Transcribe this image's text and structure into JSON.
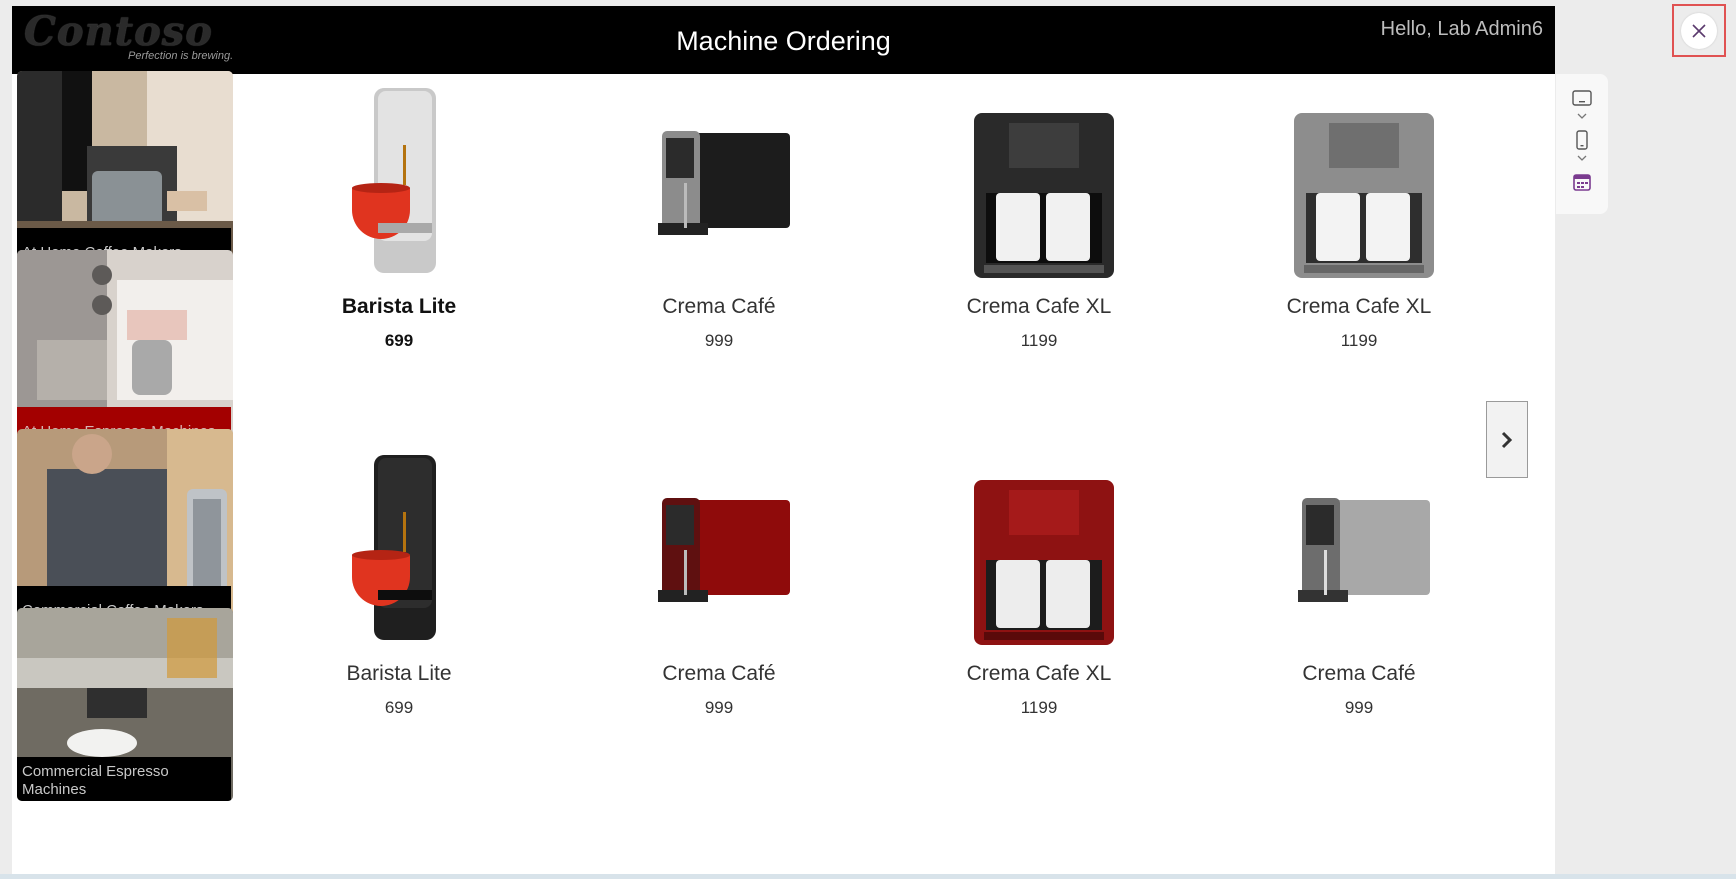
{
  "header": {
    "logo_text": "Contoso",
    "tagline": "Perfection is brewing.",
    "title": "Machine Ordering",
    "greeting": "Hello, Lab Admin6"
  },
  "categories": [
    {
      "label": "At Home Coffee Makers",
      "selected": false
    },
    {
      "label": "At Home Espresso Machines",
      "selected": true
    },
    {
      "label": "Commercial Coffee Makers",
      "selected": false
    },
    {
      "label": "Commercial Espresso Machines",
      "selected": false
    }
  ],
  "products": [
    {
      "name": "Barista Lite",
      "price": "699",
      "image": "capsule-machine-silver-icon",
      "selected": true
    },
    {
      "name": "Crema Café",
      "price": "999",
      "image": "espresso-machine-black-icon",
      "selected": false
    },
    {
      "name": "Crema Cafe XL",
      "price": "1199",
      "image": "dual-cup-machine-black-icon",
      "selected": false
    },
    {
      "name": "Crema Cafe XL",
      "price": "1199",
      "image": "dual-cup-machine-grey-icon",
      "selected": false
    },
    {
      "name": "Barista Lite",
      "price": "699",
      "image": "capsule-machine-black-icon",
      "selected": false
    },
    {
      "name": "Crema Café",
      "price": "999",
      "image": "espresso-machine-red-icon",
      "selected": false
    },
    {
      "name": "Crema Cafe XL",
      "price": "1199",
      "image": "dual-cup-machine-red-icon",
      "selected": false
    },
    {
      "name": "Crema Café",
      "price": "999",
      "image": "espresso-machine-silver-icon",
      "selected": false
    }
  ],
  "colors": {
    "header_bg": "#000000",
    "selected_category": "#a30000",
    "close_highlight": "#e05252"
  },
  "toolbar": {
    "icons": [
      "tablet-icon",
      "phone-icon",
      "calendar-icon"
    ]
  }
}
